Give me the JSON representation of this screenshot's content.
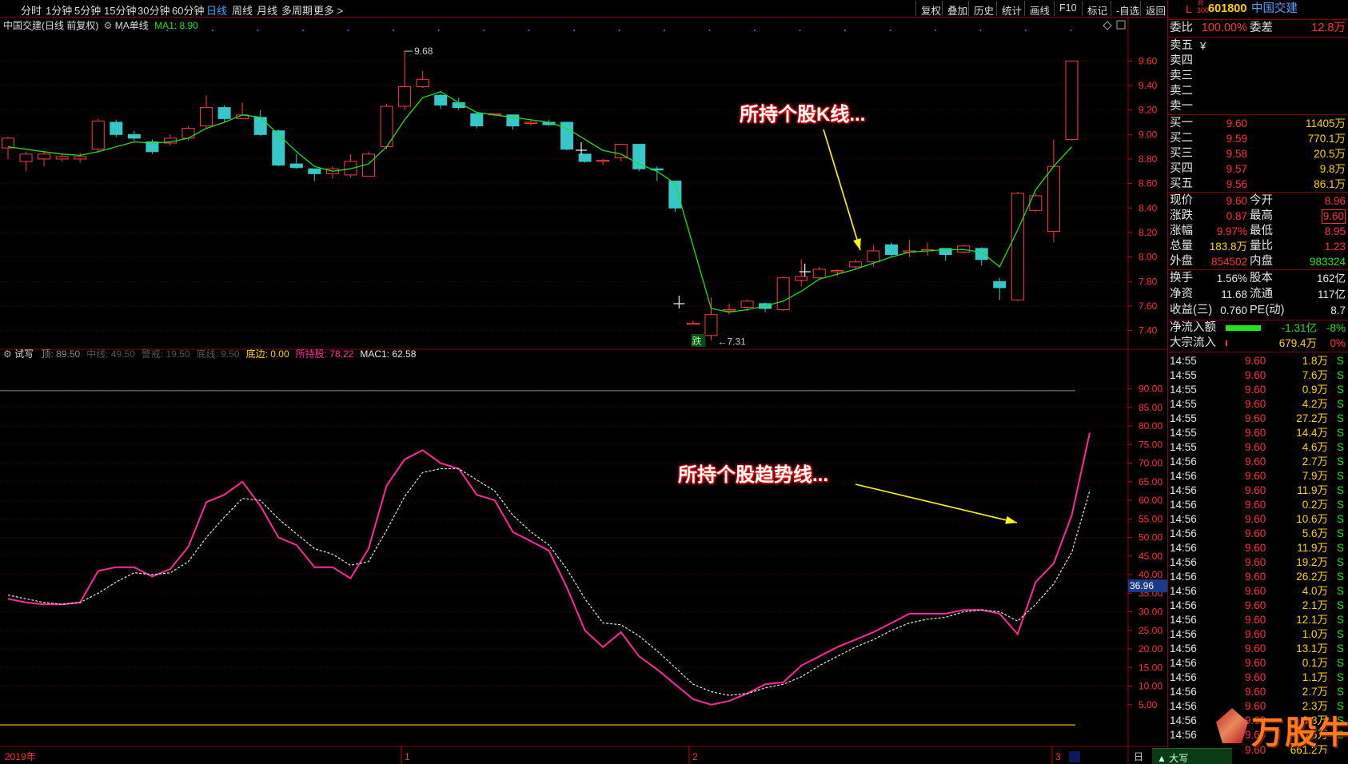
{
  "toolbar": {
    "periods": [
      "分时",
      "1分钟",
      "5分钟",
      "15分钟",
      "30分钟",
      "60分钟",
      "日线",
      "周线",
      "月线",
      "多周期",
      "更多 >"
    ],
    "active_period": "日线",
    "right_buttons": [
      "复权",
      "叠加",
      "历史",
      "统计",
      "画线",
      "F10",
      "标记",
      "-自选",
      "返回"
    ]
  },
  "kline_header": {
    "title": "中国交建(日线 前复权)",
    "ma_label": "MA单线",
    "ma_value": "MA1: 8.90"
  },
  "indicator_header": {
    "name": "试写",
    "items": [
      {
        "text": "顶: 89.50",
        "color": "#888888"
      },
      {
        "text": "中线: 49.50",
        "color": "#555555"
      },
      {
        "text": "警戒: 19.50",
        "color": "#555555"
      },
      {
        "text": "底线: 9.50",
        "color": "#555555"
      },
      {
        "text": "底边: 0.00",
        "color": "#ffd200"
      },
      {
        "text": "所持股: 78.22",
        "color": "#ff2a9a"
      },
      {
        "text": "MAC1: 62.58",
        "color": "#e6e6e6"
      }
    ]
  },
  "annotations": {
    "kline": "所持个股K线...",
    "trend": "所持个股趋势线..."
  },
  "kline_axis": [
    "9.60",
    "9.40",
    "9.20",
    "9.00",
    "8.80",
    "8.60",
    "8.40",
    "8.20",
    "8.00",
    "7.80",
    "7.60",
    "7.40"
  ],
  "ind_axis": [
    "90.00",
    "85.00",
    "80.00",
    "75.00",
    "70.00",
    "65.00",
    "60.00",
    "55.00",
    "50.00",
    "45.00",
    "40.00",
    "35.00",
    "30.00",
    "25.00",
    "20.00",
    "15.00",
    "10.00",
    "5.00"
  ],
  "ind_axis_highlight": "36.96",
  "time_axis": [
    "2019年",
    "1",
    "2",
    "3"
  ],
  "time_axis_right": "日",
  "chart_data": [
    {
      "type": "candlestick",
      "title": "中国交建(日线 前复权)",
      "ylim": [
        7.28,
        9.85
      ],
      "markers": {
        "high": "9.68",
        "low": "7.31",
        "limit_down": "跌"
      },
      "candles": [
        [
          8.89,
          8.97,
          8.8,
          8.98
        ],
        [
          8.78,
          8.84,
          8.7,
          8.86
        ],
        [
          8.8,
          8.84,
          8.74,
          8.86
        ],
        [
          8.8,
          8.82,
          8.78,
          8.84
        ],
        [
          8.8,
          8.82,
          8.77,
          8.85
        ],
        [
          8.88,
          9.11,
          8.85,
          9.13
        ],
        [
          9.1,
          9.0,
          8.98,
          9.12
        ],
        [
          9.0,
          8.97,
          8.95,
          9.03
        ],
        [
          8.94,
          8.86,
          8.84,
          8.96
        ],
        [
          8.93,
          8.97,
          8.91,
          9.0
        ],
        [
          8.97,
          9.05,
          8.95,
          9.07
        ],
        [
          9.07,
          9.22,
          9.05,
          9.32
        ],
        [
          9.22,
          9.13,
          9.1,
          9.24
        ],
        [
          9.13,
          9.16,
          9.13,
          9.26
        ],
        [
          9.14,
          9.0,
          8.99,
          9.2
        ],
        [
          9.03,
          8.75,
          8.74,
          9.04
        ],
        [
          8.76,
          8.73,
          8.72,
          8.84
        ],
        [
          8.72,
          8.68,
          8.62,
          8.72
        ],
        [
          8.68,
          8.72,
          8.64,
          8.74
        ],
        [
          8.67,
          8.78,
          8.65,
          8.84
        ],
        [
          8.66,
          8.84,
          8.66,
          8.86
        ],
        [
          8.9,
          9.23,
          8.88,
          9.25
        ],
        [
          9.23,
          9.39,
          9.2,
          9.68
        ],
        [
          9.39,
          9.45,
          9.38,
          9.52
        ],
        [
          9.32,
          9.24,
          9.21,
          9.33
        ],
        [
          9.26,
          9.22,
          9.2,
          9.3
        ],
        [
          9.17,
          9.07,
          9.05,
          9.18
        ],
        [
          9.17,
          9.17,
          9.15,
          9.17
        ],
        [
          9.16,
          9.07,
          9.04,
          9.16
        ],
        [
          9.09,
          9.1,
          9.07,
          9.12
        ],
        [
          9.1,
          9.08,
          9.07,
          9.12
        ],
        [
          9.1,
          8.88,
          8.87,
          9.1
        ],
        [
          8.84,
          8.78,
          8.77,
          8.84
        ],
        [
          8.78,
          8.79,
          8.75,
          8.8
        ],
        [
          8.81,
          8.92,
          8.78,
          8.92
        ],
        [
          8.92,
          8.72,
          8.7,
          8.92
        ],
        [
          8.72,
          8.71,
          8.62,
          8.74
        ],
        [
          8.62,
          8.4,
          8.37,
          8.62
        ],
        [
          7.46,
          7.46,
          7.45,
          7.48
        ],
        [
          7.36,
          7.53,
          7.32,
          7.67
        ],
        [
          7.57,
          7.57,
          7.53,
          7.62
        ],
        [
          7.59,
          7.64,
          7.56,
          7.65
        ],
        [
          7.62,
          7.58,
          7.55,
          7.63
        ],
        [
          7.57,
          7.83,
          7.56,
          7.84
        ],
        [
          7.81,
          7.84,
          7.76,
          7.98
        ],
        [
          7.83,
          7.9,
          7.82,
          7.92
        ],
        [
          7.88,
          7.89,
          7.84,
          7.9
        ],
        [
          7.92,
          7.96,
          7.9,
          7.98
        ],
        [
          7.96,
          8.05,
          7.92,
          8.1
        ],
        [
          8.1,
          8.02,
          8.0,
          8.12
        ],
        [
          8.04,
          8.05,
          8.0,
          8.14
        ],
        [
          8.06,
          8.06,
          8.01,
          8.12
        ],
        [
          8.07,
          8.02,
          7.97,
          8.07
        ],
        [
          8.04,
          8.09,
          8.03,
          8.1
        ],
        [
          8.07,
          7.98,
          7.93,
          8.08
        ],
        [
          7.8,
          7.75,
          7.65,
          7.83
        ],
        [
          7.65,
          8.52,
          7.64,
          8.53
        ],
        [
          8.38,
          8.5,
          8.37,
          8.52
        ],
        [
          8.21,
          8.74,
          8.12,
          8.96
        ],
        [
          8.96,
          9.6,
          8.95,
          9.6
        ]
      ],
      "ma1": [
        8.9,
        8.88,
        8.86,
        8.84,
        8.83,
        8.86,
        8.9,
        8.94,
        8.93,
        8.94,
        8.97,
        9.05,
        9.1,
        9.16,
        9.14,
        9.0,
        8.86,
        8.74,
        8.7,
        8.72,
        8.76,
        8.9,
        9.12,
        9.3,
        9.35,
        9.26,
        9.18,
        9.16,
        9.14,
        9.12,
        9.1,
        9.05,
        8.96,
        8.87,
        8.84,
        8.76,
        8.7,
        8.6,
        8.09,
        7.58,
        7.55,
        7.57,
        7.6,
        7.64,
        7.72,
        7.82,
        7.86,
        7.9,
        7.95,
        8.0,
        8.04,
        8.05,
        8.06,
        8.06,
        8.04,
        7.92,
        8.22,
        8.55,
        8.74,
        8.9
      ]
    },
    {
      "type": "line",
      "title": "试写",
      "ylim": [
        0,
        94
      ],
      "series": [
        {
          "name": "所持股",
          "color": "#ff2a9a",
          "values": [
            33.5,
            32.5,
            32,
            32,
            32.5,
            41,
            42,
            42,
            39.5,
            41.5,
            47.5,
            59.5,
            61.5,
            65,
            58.5,
            50,
            48,
            42,
            42,
            39,
            47,
            64,
            71,
            73.5,
            70,
            68.5,
            61.5,
            60,
            51.5,
            49,
            46.5,
            36.5,
            25,
            20.5,
            24.5,
            18,
            14.5,
            10.5,
            6.5,
            5,
            6,
            8,
            10.5,
            11,
            15.5,
            18,
            20.5,
            22.5,
            24.5,
            27,
            29.5,
            29.5,
            29.5,
            30.5,
            30.5,
            29.5,
            24,
            38,
            43,
            56,
            78.2
          ]
        },
        {
          "name": "MAC1",
          "color": "#e6e6e6",
          "dashed": true,
          "values": [
            34.5,
            33.5,
            32.5,
            32,
            32.5,
            35,
            38,
            40.5,
            40,
            40.5,
            43.5,
            50,
            55.5,
            60.5,
            60,
            55,
            51,
            47,
            45.5,
            42.5,
            43.5,
            52,
            61,
            67.5,
            68.5,
            68.5,
            65.5,
            62.5,
            56,
            51.5,
            48,
            41.5,
            33.5,
            27,
            26.5,
            23.5,
            19.5,
            15,
            10.5,
            8.5,
            7.5,
            8,
            9.5,
            10.5,
            12.5,
            15.5,
            18,
            20.5,
            22.5,
            25,
            27,
            28,
            28.5,
            30,
            30.5,
            30,
            27.5,
            32,
            37.5,
            46,
            62.6
          ]
        }
      ]
    }
  ],
  "stock": {
    "flag": "L",
    "r300": "R\n300",
    "code": "601800",
    "name": "中国交建"
  },
  "quote": {
    "wei_bi_label": "委比",
    "wei_bi": "100.00%",
    "wei_cha_label": "委差",
    "wei_cha": "12.8万",
    "sell": [
      {
        "l": "卖五",
        "p": "¥",
        "v": ""
      },
      {
        "l": "卖四",
        "p": "",
        "v": ""
      },
      {
        "l": "卖三",
        "p": "",
        "v": ""
      },
      {
        "l": "卖二",
        "p": "",
        "v": ""
      },
      {
        "l": "卖一",
        "p": "",
        "v": ""
      }
    ],
    "buy": [
      {
        "l": "买一",
        "p": "9.60",
        "v": "11405万"
      },
      {
        "l": "买二",
        "p": "9.59",
        "v": "770.1万"
      },
      {
        "l": "买三",
        "p": "9.58",
        "v": "20.5万"
      },
      {
        "l": "买四",
        "p": "9.57",
        "v": "9.8万"
      },
      {
        "l": "买五",
        "p": "9.56",
        "v": "86.1万"
      }
    ],
    "stats": [
      {
        "l1": "现价",
        "v1": "9.60",
        "c1": "red",
        "l2": "今开",
        "v2": "8.96",
        "c2": "red"
      },
      {
        "l1": "涨跌",
        "v1": "0.87",
        "c1": "red",
        "l2": "最高",
        "v2": "9.60",
        "c2": "red"
      },
      {
        "l1": "涨幅",
        "v1": "9.97%",
        "c1": "red",
        "l2": "最低",
        "v2": "8.95",
        "c2": "red"
      },
      {
        "l1": "总量",
        "v1": "183.8万",
        "c1": "yellow",
        "l2": "量比",
        "v2": "1.23",
        "c2": "red"
      },
      {
        "l1": "外盘",
        "v1": "854502",
        "c1": "red",
        "l2": "内盘",
        "v2": "983324",
        "c2": "green"
      }
    ],
    "stats2": [
      {
        "l1": "换手",
        "v1": "1.56%",
        "l2": "股本",
        "v2": "162亿"
      },
      {
        "l1": "净资",
        "v1": "11.68",
        "l2": "流通",
        "v2": "117亿"
      },
      {
        "l1": "收益(三)",
        "v1": "0.760",
        "l2": "PE(动)",
        "v2": "8.7"
      }
    ],
    "flow": [
      {
        "l": "净流入额",
        "v": "-1.31亿",
        "p": "-8%",
        "vc": "green",
        "pc": "green"
      },
      {
        "l": "大宗流入",
        "v": "679.4万",
        "p": "0%",
        "vc": "yellow",
        "pc": "red"
      }
    ]
  },
  "ticks": [
    {
      "t": "14:55",
      "p": "9.60",
      "v": "1.8万",
      "s": "S"
    },
    {
      "t": "14:55",
      "p": "9.60",
      "v": "7.6万",
      "s": "S"
    },
    {
      "t": "14:55",
      "p": "9.60",
      "v": "0.9万",
      "s": "S"
    },
    {
      "t": "14:55",
      "p": "9.60",
      "v": "4.2万",
      "s": "S"
    },
    {
      "t": "14:55",
      "p": "9.60",
      "v": "27.2万",
      "s": "S"
    },
    {
      "t": "14:55",
      "p": "9.60",
      "v": "14.4万",
      "s": "S"
    },
    {
      "t": "14:55",
      "p": "9.60",
      "v": "4.6万",
      "s": "S"
    },
    {
      "t": "14:56",
      "p": "9.60",
      "v": "2.7万",
      "s": "S"
    },
    {
      "t": "14:56",
      "p": "9.60",
      "v": "7.9万",
      "s": "S"
    },
    {
      "t": "14:56",
      "p": "9.60",
      "v": "11.9万",
      "s": "S"
    },
    {
      "t": "14:56",
      "p": "9.60",
      "v": "0.2万",
      "s": "S"
    },
    {
      "t": "14:56",
      "p": "9.60",
      "v": "10.6万",
      "s": "S"
    },
    {
      "t": "14:56",
      "p": "9.60",
      "v": "5.6万",
      "s": "S"
    },
    {
      "t": "14:56",
      "p": "9.60",
      "v": "11.9万",
      "s": "S"
    },
    {
      "t": "14:56",
      "p": "9.60",
      "v": "19.2万",
      "s": "S"
    },
    {
      "t": "14:56",
      "p": "9.60",
      "v": "26.2万",
      "s": "S"
    },
    {
      "t": "14:56",
      "p": "9.60",
      "v": "4.0万",
      "s": "S"
    },
    {
      "t": "14:56",
      "p": "9.60",
      "v": "2.1万",
      "s": "S"
    },
    {
      "t": "14:56",
      "p": "9.60",
      "v": "12.1万",
      "s": "S"
    },
    {
      "t": "14:56",
      "p": "9.60",
      "v": "1.0万",
      "s": "S"
    },
    {
      "t": "14:56",
      "p": "9.60",
      "v": "13.1万",
      "s": "S"
    },
    {
      "t": "14:56",
      "p": "9.60",
      "v": "0.1万",
      "s": "S"
    },
    {
      "t": "14:56",
      "p": "9.60",
      "v": "1.1万",
      "s": "S"
    },
    {
      "t": "14:56",
      "p": "9.60",
      "v": "2.7万",
      "s": "S"
    },
    {
      "t": "14:56",
      "p": "9.60",
      "v": "2.3万",
      "s": "S"
    },
    {
      "t": "14:56",
      "p": "9.60",
      "v": "0.8万",
      "s": "S"
    },
    {
      "t": "14:56",
      "p": "9.60",
      "v": "0.5万",
      "s": "S"
    }
  ],
  "ticks_more": "9.60",
  "ticks_more_v": "661.2万",
  "watermark": "万股牛",
  "bottom_tab": "大写",
  "colors": {
    "up": "#ff3c3c",
    "down": "#36c8c8",
    "ma": "#20e020",
    "grid": "#5a0000",
    "axis_text": "#ff3232"
  }
}
